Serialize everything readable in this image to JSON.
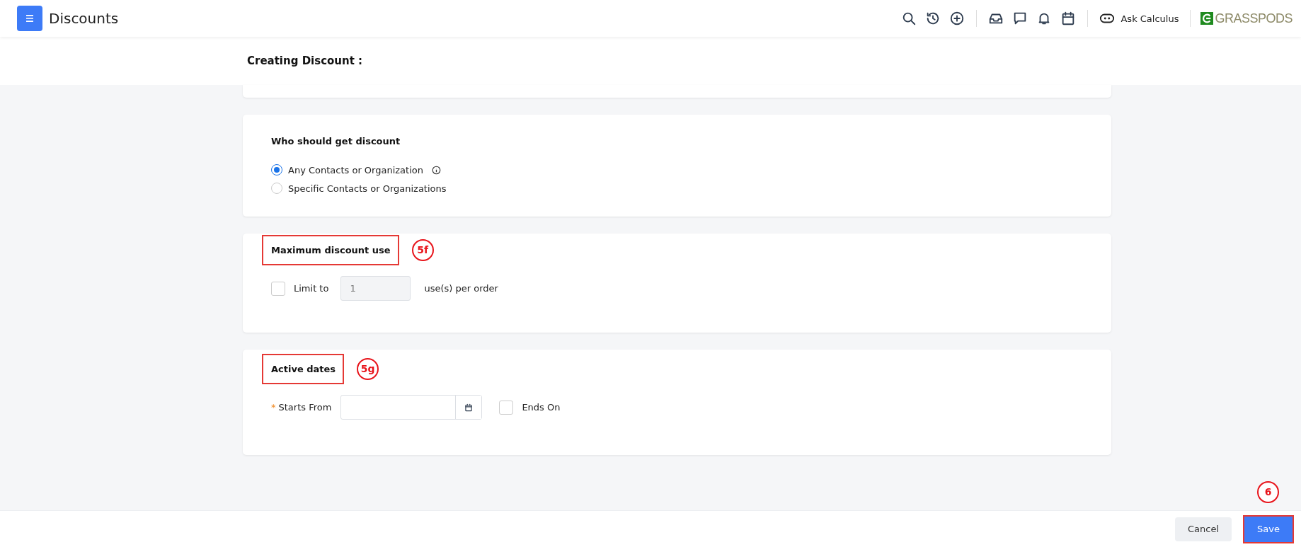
{
  "header": {
    "title": "Discounts",
    "ask_label": "Ask Calculus",
    "logo_text": "GRASSPODS"
  },
  "page_title": "Creating Discount :",
  "sections": [
    {
      "kind": "radio",
      "title": "Who should get discount",
      "options": [
        {
          "label": "Any Contacts or Organization",
          "selected": true,
          "info": true
        },
        {
          "label": "Specific Contacts or Organizations",
          "selected": false,
          "info": false
        }
      ]
    },
    {
      "kind": "limit",
      "title": "Maximum discount use",
      "annotation": "5f",
      "checkbox_label": "Limit to",
      "checked": false,
      "value": "1",
      "suffix": "use(s) per order"
    },
    {
      "kind": "dates",
      "title": "Active dates",
      "annotation": "5g",
      "required_mark": "*",
      "start_label": "Starts From",
      "end_label": "Ends On",
      "end_checked": false
    }
  ],
  "footer": {
    "buttons": [
      {
        "label": "Cancel",
        "kind": "secondary"
      },
      {
        "label": "Save",
        "kind": "primary",
        "annotation": "6"
      }
    ]
  }
}
